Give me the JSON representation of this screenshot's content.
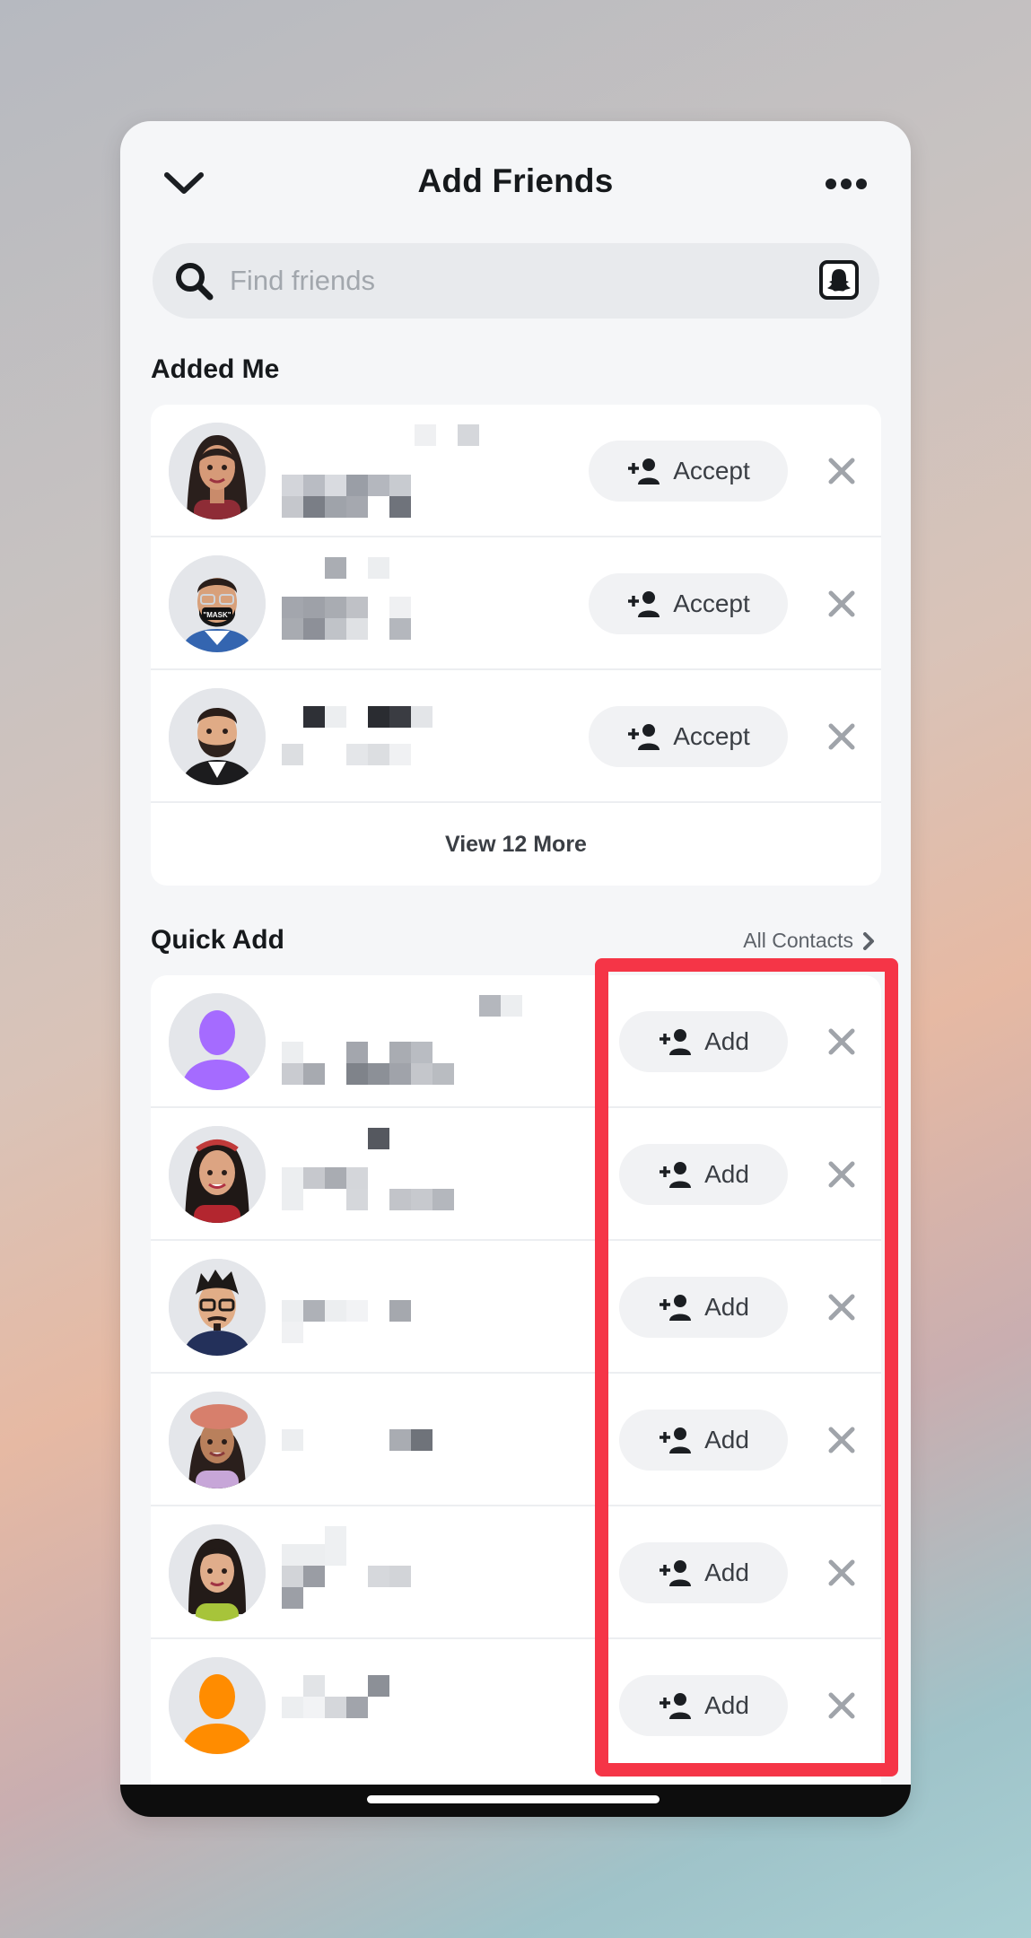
{
  "header": {
    "title": "Add Friends"
  },
  "search": {
    "placeholder": "Find friends"
  },
  "added_me": {
    "title": "Added Me",
    "rows": [
      {
        "action_label": "Accept"
      },
      {
        "action_label": "Accept"
      },
      {
        "action_label": "Accept"
      }
    ],
    "view_more_label": "View 12 More"
  },
  "quick_add": {
    "title": "Quick Add",
    "all_contacts_label": "All Contacts",
    "rows": [
      {
        "action_label": "Add",
        "avatar": "purple-silhouette"
      },
      {
        "action_label": "Add",
        "avatar": "bitmoji-woman-headband"
      },
      {
        "action_label": "Add",
        "avatar": "bitmoji-man-glasses"
      },
      {
        "action_label": "Add",
        "avatar": "bitmoji-woman-beret"
      },
      {
        "action_label": "Add",
        "avatar": "bitmoji-woman-green"
      },
      {
        "action_label": "Add",
        "avatar": "orange-silhouette"
      }
    ]
  },
  "colors": {
    "highlight": "#f53547",
    "purple_avatar": "#a56bff",
    "orange_avatar": "#ff8c00"
  }
}
